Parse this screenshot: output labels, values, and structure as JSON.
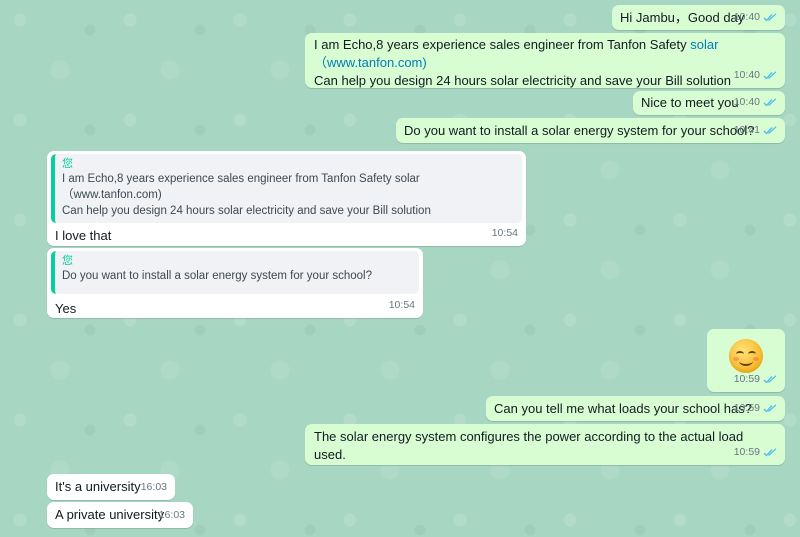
{
  "chat": {
    "messages": [
      {
        "dir": "out",
        "text": "Hi Jambu，Good day",
        "time": "10:40",
        "status": "read"
      },
      {
        "dir": "out",
        "line1_prefix": "I am Echo,8 years experience sales engineer from Tanfon Safety ",
        "line1_link": "solar",
        "line2": "（www.tanfon.com)",
        "line3": "Can help you design 24 hours solar electricity and save your Bill solution",
        "time": "10:40",
        "status": "read"
      },
      {
        "dir": "out",
        "text": "Nice to meet you",
        "time": "10:40",
        "status": "read"
      },
      {
        "dir": "out",
        "text": "Do you want to install a solar energy system for your school?",
        "time": "10:41",
        "status": "read"
      },
      {
        "dir": "in",
        "quote_author": "您",
        "quote_line1": "I am Echo,8 years experience sales engineer from Tanfon Safety solar",
        "quote_line2": "（www.tanfon.com)",
        "quote_line3": "Can help you design 24 hours solar electricity and save your Bill solution",
        "text": "I love that",
        "time": "10:54"
      },
      {
        "dir": "in",
        "quote_author": "您",
        "quote_line1": "Do you want to install a solar energy system for your school?",
        "text": "Yes",
        "time": "10:54"
      },
      {
        "dir": "out",
        "emoji": "smiling-face",
        "time": "10:59",
        "status": "read"
      },
      {
        "dir": "out",
        "text": "Can you tell me what loads your school has?",
        "time": "10:59",
        "status": "read"
      },
      {
        "dir": "out",
        "text": "The solar energy system configures the power according to the actual load used.",
        "time": "10:59",
        "status": "read"
      },
      {
        "dir": "in",
        "text": "It's a  university",
        "time": "16:03"
      },
      {
        "dir": "in",
        "text": "A private university",
        "time": "16:03"
      }
    ]
  },
  "colors": {
    "wallpaper": "#a7d6c2",
    "outgoing_bubble": "#d9fdd3",
    "incoming_bubble": "#ffffff",
    "read_ticks": "#53bdeb",
    "quote_accent": "#06cf9c",
    "link": "#027eb5"
  },
  "icons": {
    "read_receipt": "double-check-icon",
    "emoji": "smiling-face-emoji"
  }
}
